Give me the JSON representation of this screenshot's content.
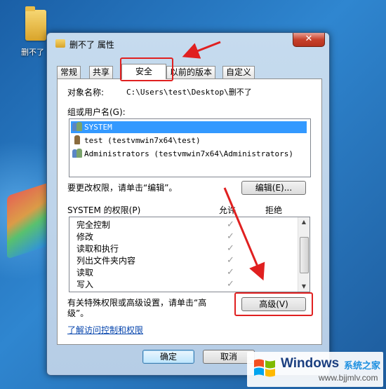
{
  "desktop": {
    "folder_label": "删不了"
  },
  "window": {
    "title": "删不了 属性",
    "close_glyph": "✕"
  },
  "tabs": [
    {
      "label": "常规"
    },
    {
      "label": "共享"
    },
    {
      "label": "安全"
    },
    {
      "label": "以前的版本"
    },
    {
      "label": "自定义"
    }
  ],
  "security": {
    "object_name_label": "对象名称:",
    "object_name_value": "C:\\Users\\test\\Desktop\\删不了",
    "group_label": "组或用户名(G):",
    "users": [
      {
        "name": "SYSTEM",
        "selected": true,
        "icon": "group-user-icon"
      },
      {
        "name": "test (testvmwin7x64\\test)",
        "selected": false,
        "icon": "single-user-icon"
      },
      {
        "name": "Administrators (testvmwin7x64\\Administrators)",
        "selected": false,
        "icon": "group-user-icon"
      }
    ],
    "change_hint": "要更改权限，请单击“编辑”。",
    "edit_button": "编辑(E)...",
    "perm_header": "SYSTEM 的权限(P)",
    "allow_header": "允许",
    "deny_header": "拒绝",
    "permissions": [
      {
        "name": "完全控制",
        "allow": "✓"
      },
      {
        "name": "修改",
        "allow": "✓"
      },
      {
        "name": "读取和执行",
        "allow": "✓"
      },
      {
        "name": "列出文件夹内容",
        "allow": "✓"
      },
      {
        "name": "读取",
        "allow": "✓"
      },
      {
        "name": "写入",
        "allow": "✓"
      }
    ],
    "advanced_hint_line1": "有关特殊权限或高级设置，请单击“高",
    "advanced_hint_line2": "级”。",
    "advanced_button": "高级(V)",
    "learn_link": "了解访问控制和权限"
  },
  "footer": {
    "ok_button": "确定",
    "cancel_button": "取消"
  },
  "watermark": {
    "brand": "Windows",
    "sub": "系统之家",
    "url": "www.bjjmlv.com"
  },
  "colors": {
    "selection": "#3399ff",
    "annotation_red": "#e02020",
    "link": "#0645ad"
  }
}
